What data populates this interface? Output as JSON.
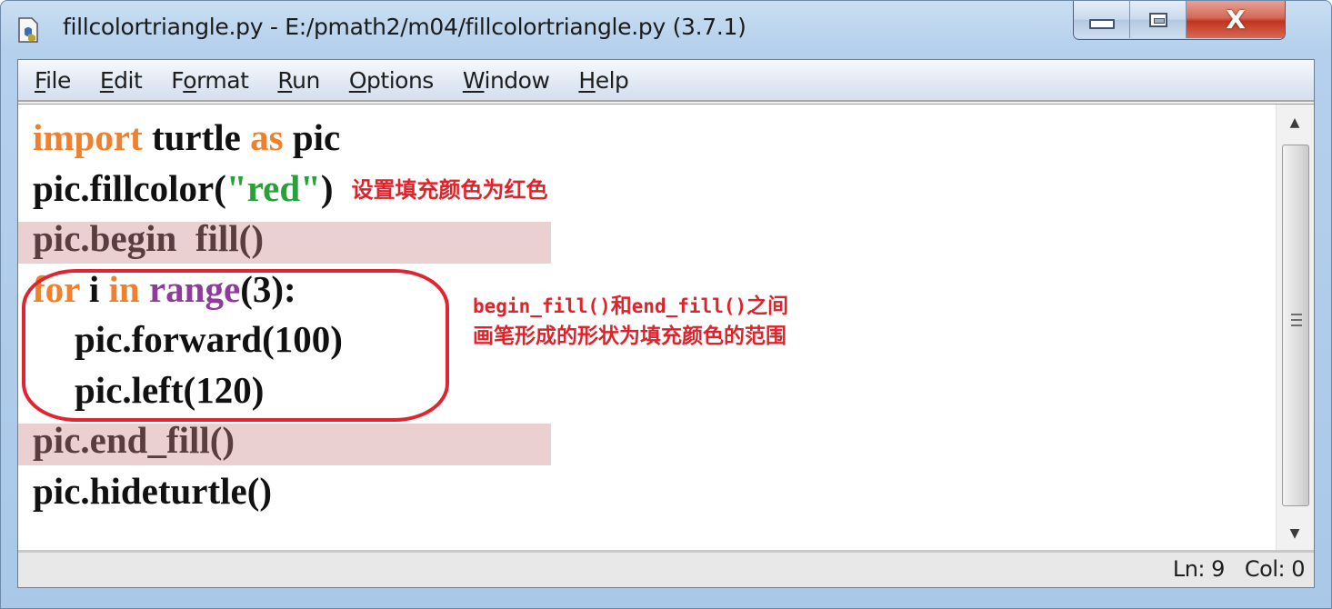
{
  "window": {
    "title": "fillcolortriangle.py - E:/pmath2/m04/fillcolortriangle.py (3.7.1)",
    "app_icon": "python-file-icon",
    "controls": {
      "minimize_icon": "minimize-icon",
      "maximize_icon": "maximize-icon",
      "close_icon": "close-icon",
      "close_glyph": "X"
    }
  },
  "menubar": {
    "items": [
      {
        "mnemonic": "F",
        "rest": "ile"
      },
      {
        "mnemonic": "E",
        "rest": "dit"
      },
      {
        "pre": "F",
        "mnemonic": "o",
        "rest": "rmat"
      },
      {
        "mnemonic": "R",
        "rest": "un"
      },
      {
        "mnemonic": "O",
        "rest": "ptions"
      },
      {
        "mnemonic": "W",
        "rest": "indow"
      },
      {
        "mnemonic": "H",
        "rest": "elp"
      }
    ]
  },
  "editor": {
    "lines": [
      {
        "kw1": "import",
        "t1": " turtle ",
        "kw2": "as",
        "t2": " pic"
      },
      {
        "t1": "pic.fillcolor(",
        "str": "\"red\"",
        "t2": ")",
        "note": "设置填充颜色为红色"
      },
      {
        "t1": "pic.begin  fill()"
      },
      {
        "kw1": "for",
        "t1": " i ",
        "kw2": "in",
        "t2": " ",
        "bi": "range",
        "t3": "(3):"
      },
      {
        "t1": "pic.forward(100)"
      },
      {
        "t1": "pic.left(120)"
      },
      {
        "t1": "pic.end_fill()"
      },
      {
        "t1": "pic.hideturtle()"
      }
    ],
    "annotation": {
      "line1_mono": "begin_fill()",
      "line1_mid": "和",
      "line1_mono2": "end_fill()",
      "line1_end": "之间",
      "line2": "画笔形成的形状为填充颜色的范围"
    },
    "colors": {
      "keyword": "#f07f2e",
      "string": "#29a13b",
      "builtin": "#8e3c9a",
      "annotation": "#e0222a",
      "highlight": "#ead0d0"
    }
  },
  "scrollbar": {
    "up_arrow": "▲",
    "down_arrow": "▼"
  },
  "status": {
    "line": "Ln: 9",
    "col": "Col: 0"
  }
}
